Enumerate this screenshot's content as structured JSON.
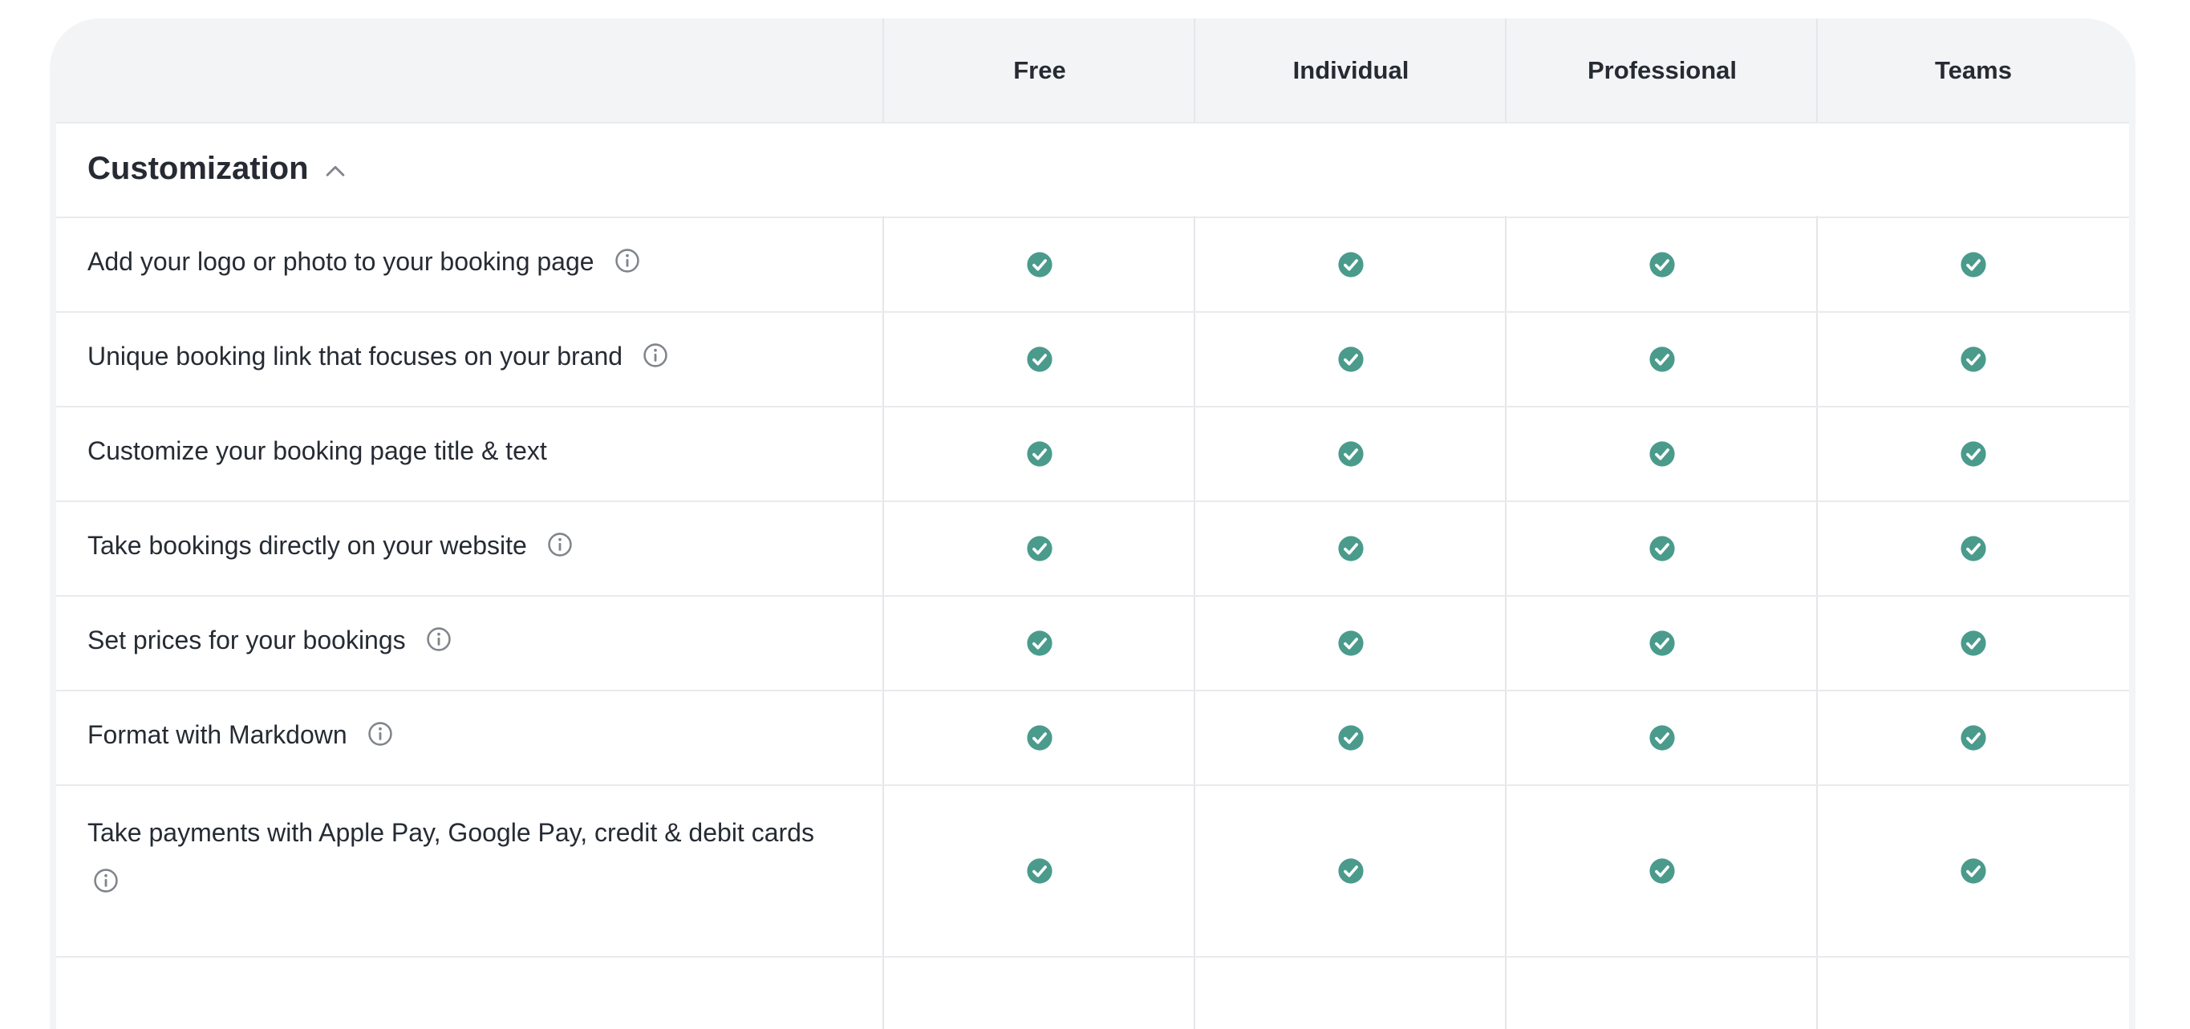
{
  "columns": [
    "Free",
    "Individual",
    "Professional",
    "Teams"
  ],
  "section": {
    "title": "Customization",
    "expanded": true
  },
  "rows": [
    {
      "label": "Add your logo or photo to your booking page",
      "info": true,
      "values": [
        true,
        true,
        true,
        true
      ]
    },
    {
      "label": "Unique booking link that focuses on your brand",
      "info": true,
      "values": [
        true,
        true,
        true,
        true
      ]
    },
    {
      "label": "Customize your booking page title & text",
      "info": false,
      "values": [
        true,
        true,
        true,
        true
      ]
    },
    {
      "label": "Take bookings directly on your website",
      "info": true,
      "values": [
        true,
        true,
        true,
        true
      ]
    },
    {
      "label": "Set prices for your bookings",
      "info": true,
      "values": [
        true,
        true,
        true,
        true
      ]
    },
    {
      "label": "Format with Markdown",
      "info": true,
      "values": [
        true,
        true,
        true,
        true
      ]
    },
    {
      "label": "Take payments with Apple Pay, Google Pay, credit & debit cards",
      "info": true,
      "values": [
        true,
        true,
        true,
        true
      ]
    }
  ],
  "colors": {
    "check": "#4a9b8c",
    "info": "#80858c",
    "header_bg": "#f3f4f6",
    "border": "#e4e6ea"
  },
  "icons": {
    "check": "check-circle-icon",
    "info": "info-circle-icon",
    "collapse": "chevron-up-icon"
  }
}
